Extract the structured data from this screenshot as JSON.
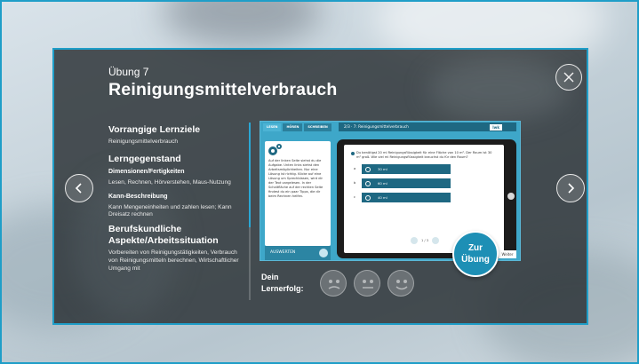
{
  "exercise": {
    "label": "Übung 7",
    "title": "Reinigungsmittelverbrauch"
  },
  "sections": {
    "goals_heading": "Vorrangige Lernziele",
    "goals_text": "Reinigungsmittelverbrauch",
    "level_heading": "Lerngegenstand",
    "dims_heading": "Dimensionen/Fertigkeiten",
    "dims_text": "Lesen, Rechnen, Hörverstehen, Maus-Nutzung",
    "can_heading": "Kann-Beschreibung",
    "can_text": "Kann Mengeneinheiten und zahlen lesen; Kann Dreisatz rechnen",
    "context_heading": "Berufskundliche Aspekte/Arbeitssituation",
    "context_text": "Vorbereiten von Reinigungstätigkeiten, Verbrauch von Reinigungsmitteln berechnen, Wirtschaftlicher Umgang mit"
  },
  "preview": {
    "tabs": [
      "LESEN",
      "HÖREN",
      "SCHREIBEN"
    ],
    "bar_title": "2/3 · 7: Reinigungsmittelverbrauch",
    "brand": "lwk",
    "info_text": "Auf der linken Seite siehst du die Aufgabe. Unten links siehst den Arbeitsmöglichkeiten. Nur eine Lösung ist richtig. Klicke auf eine Lösung um Sprechblasen, wird dir der Text vorgelesen. In der Schaltfläche auf der rechten Seite findest du ein paar Tipps, die dir beim Rechnen helfen.",
    "evaluate": "AUSWERTEN",
    "question": "Du benötigst 20 ml Reinigungsflüssigkeit für eine Fläche von 10 m². Der Raum ist 30 m² groß. Wie viel ml Reinigungsflüssigkeit brauchst du für den Raum?",
    "answers": [
      {
        "letter": "a",
        "text": "30 ml"
      },
      {
        "letter": "b",
        "text": "60 ml"
      },
      {
        "letter": "c",
        "text": "40 ml"
      }
    ],
    "pager": "1 / 3",
    "next_label": "Weiter"
  },
  "cta": {
    "line1": "Zur",
    "line2": "Übung"
  },
  "success": {
    "line1": "Dein",
    "line2": "Lernerfolg:"
  },
  "colors": {
    "accent": "#1f9ec8",
    "button": "#1d8fb5",
    "panel": "#242a2e"
  }
}
